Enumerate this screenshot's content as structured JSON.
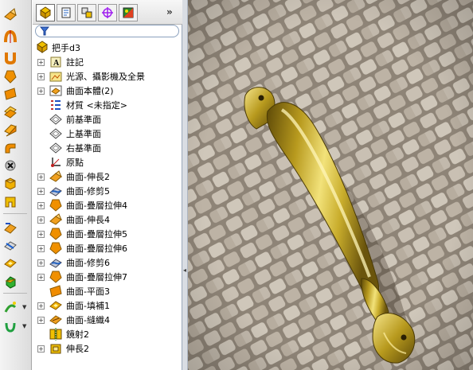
{
  "panel": {
    "expand_tabs_glyph": "»",
    "tabs": [
      {
        "name": "feature-manager-tab-icon",
        "active": true
      },
      {
        "name": "property-manager-tab-icon",
        "active": false
      },
      {
        "name": "configuration-manager-tab-icon",
        "active": false
      },
      {
        "name": "dimxpert-manager-tab-icon",
        "active": false
      },
      {
        "name": "display-manager-tab-icon",
        "active": false
      }
    ],
    "filter": {
      "icon": "filter-icon",
      "value": ""
    }
  },
  "tree": {
    "root": {
      "label": "把手d3",
      "icon": "part-icon"
    },
    "items": [
      {
        "label": "註記",
        "icon": "annotations-icon",
        "expandable": true
      },
      {
        "label": "光源、攝影機及全景",
        "icon": "lights-cameras-scene-icon",
        "expandable": true
      },
      {
        "label": "曲面本體(2)",
        "icon": "surface-bodies-icon",
        "expandable": true
      },
      {
        "label": "材質 <未指定>",
        "icon": "material-icon",
        "expandable": false
      },
      {
        "label": "前基準面",
        "icon": "plane-icon",
        "expandable": false
      },
      {
        "label": "上基準面",
        "icon": "plane-icon",
        "expandable": false
      },
      {
        "label": "右基準面",
        "icon": "plane-icon",
        "expandable": false
      },
      {
        "label": "原點",
        "icon": "origin-icon",
        "expandable": false
      },
      {
        "label": "曲面-伸長2",
        "icon": "extruded-surface-icon",
        "expandable": true
      },
      {
        "label": "曲面-修剪5",
        "icon": "trimmed-surface-icon",
        "expandable": true
      },
      {
        "label": "曲面-疊層拉伸4",
        "icon": "lofted-surface-icon",
        "expandable": true
      },
      {
        "label": "曲面-伸長4",
        "icon": "extruded-surface-icon",
        "expandable": true
      },
      {
        "label": "曲面-疊層拉伸5",
        "icon": "lofted-surface-icon",
        "expandable": true
      },
      {
        "label": "曲面-疊層拉伸6",
        "icon": "lofted-surface-icon",
        "expandable": true
      },
      {
        "label": "曲面-修剪6",
        "icon": "trimmed-surface-icon",
        "expandable": true
      },
      {
        "label": "曲面-疊層拉伸7",
        "icon": "lofted-surface-icon",
        "expandable": true
      },
      {
        "label": "曲面-平面3",
        "icon": "planar-surface-icon",
        "expandable": false
      },
      {
        "label": "曲面-填補1",
        "icon": "filled-surface-icon",
        "expandable": true
      },
      {
        "label": "曲面-縫織4",
        "icon": "knit-surface-icon",
        "expandable": true
      },
      {
        "label": "鏡射2",
        "icon": "mirror-icon",
        "expandable": false
      },
      {
        "label": "伸長2",
        "icon": "extrude-icon",
        "expandable": true
      }
    ]
  },
  "toolbar": {
    "buttons": [
      {
        "name": "extruded-surface-tool-icon"
      },
      {
        "name": "revolved-surface-tool-icon"
      },
      {
        "name": "swept-surface-tool-icon"
      },
      {
        "name": "lofted-surface-tool-icon"
      },
      {
        "name": "planar-surface-tool-icon"
      },
      {
        "name": "offset-surface-tool-icon"
      },
      {
        "name": "ruled-surface-tool-icon"
      },
      {
        "name": "radiate-surface-tool-icon"
      },
      {
        "name": "knit-surface-tool-icon"
      },
      {
        "name": "untrim-surface-tool-icon"
      },
      {
        "name": "trim-surface-tool-icon"
      },
      {
        "name": "extend-surface-tool-icon"
      },
      {
        "name": "delete-face-tool-icon"
      },
      {
        "name": "fill-surface-tool-icon"
      },
      {
        "name": "move-face-tool-icon"
      },
      {
        "name": "thicken-tool-icon"
      }
    ]
  },
  "colors": {
    "gold": "#b89a1e",
    "gold_light": "#f2e27a",
    "gold_dark": "#5e4a08",
    "stone": "#a59a8b",
    "accent_purple": "#a020f0"
  }
}
